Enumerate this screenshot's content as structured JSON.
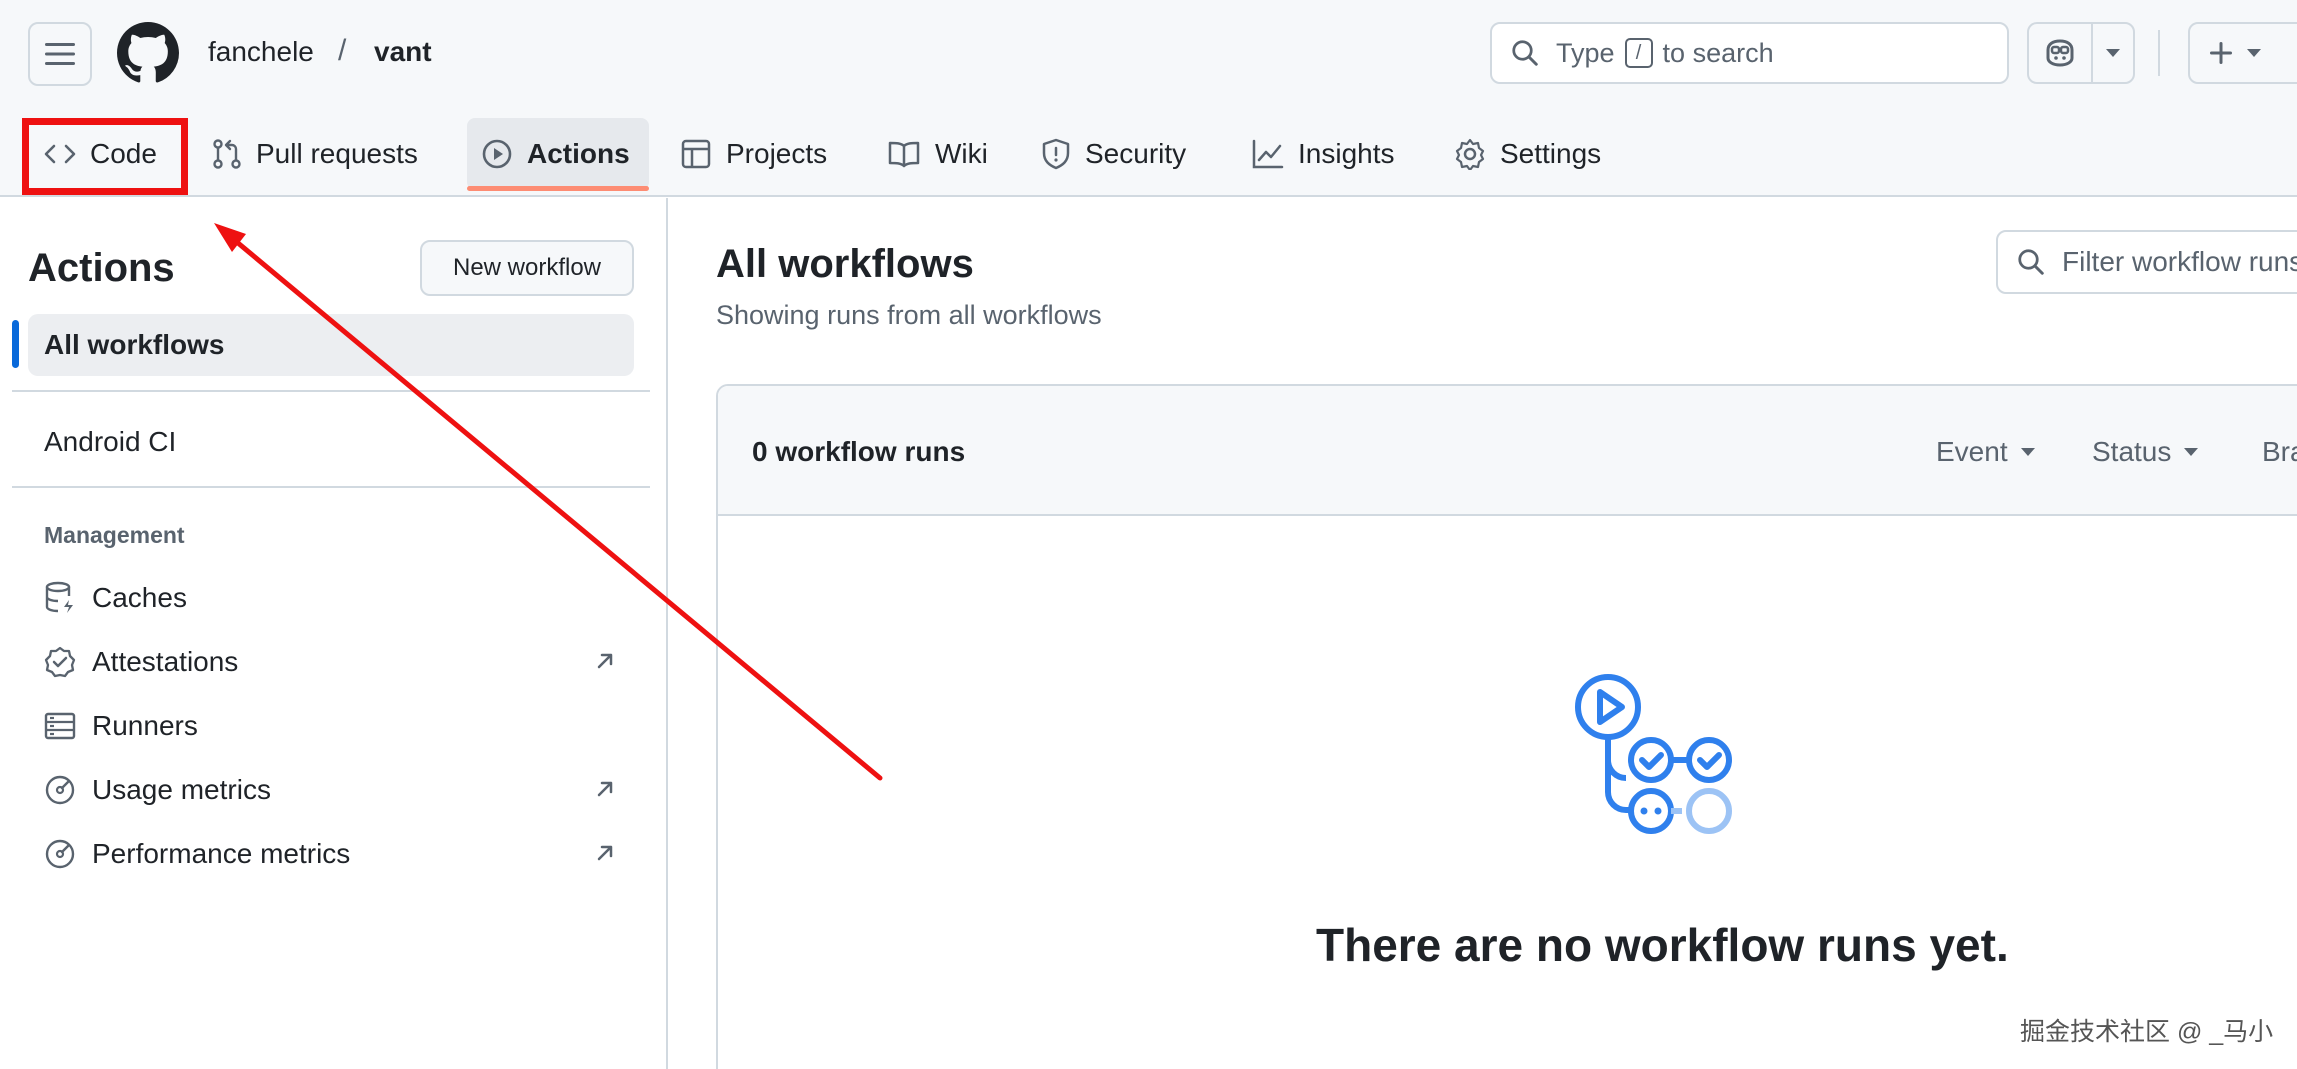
{
  "header": {
    "owner": "fanchele",
    "separator": "/",
    "repo": "vant",
    "search_prefix": "Type",
    "search_key": "/",
    "search_suffix": "to search"
  },
  "nav": {
    "tabs": [
      {
        "label": "Code",
        "icon": "code-icon"
      },
      {
        "label": "Pull requests",
        "icon": "git-pull-request-icon"
      },
      {
        "label": "Actions",
        "icon": "play-icon"
      },
      {
        "label": "Projects",
        "icon": "table-icon"
      },
      {
        "label": "Wiki",
        "icon": "book-icon"
      },
      {
        "label": "Security",
        "icon": "shield-icon"
      },
      {
        "label": "Insights",
        "icon": "graph-icon"
      },
      {
        "label": "Settings",
        "icon": "gear-icon"
      }
    ],
    "active": "Actions",
    "highlighted": "Code"
  },
  "sidebar": {
    "title": "Actions",
    "new_workflow": "New workflow",
    "all_workflows": "All workflows",
    "workflows": [
      "Android CI"
    ],
    "management_heading": "Management",
    "management_items": [
      {
        "label": "Caches",
        "icon": "database-icon",
        "external": false
      },
      {
        "label": "Attestations",
        "icon": "verified-icon",
        "external": true
      },
      {
        "label": "Runners",
        "icon": "server-icon",
        "external": false
      },
      {
        "label": "Usage metrics",
        "icon": "meter-icon",
        "external": true
      },
      {
        "label": "Performance metrics",
        "icon": "meter-icon",
        "external": true
      }
    ]
  },
  "main": {
    "title": "All workflows",
    "subtitle": "Showing runs from all workflows",
    "filter_placeholder": "Filter workflow runs",
    "runs_count": "0 workflow runs",
    "filters": [
      "Event",
      "Status",
      "Branch"
    ],
    "empty_message": "There are no workflow runs yet."
  },
  "colors": {
    "accent": "#0969da",
    "highlight": "#ee1111",
    "tab_underline": "#fd8c73",
    "empty_icon": "#2f80ed"
  },
  "watermark": "掘金技术社区 @ _马小"
}
